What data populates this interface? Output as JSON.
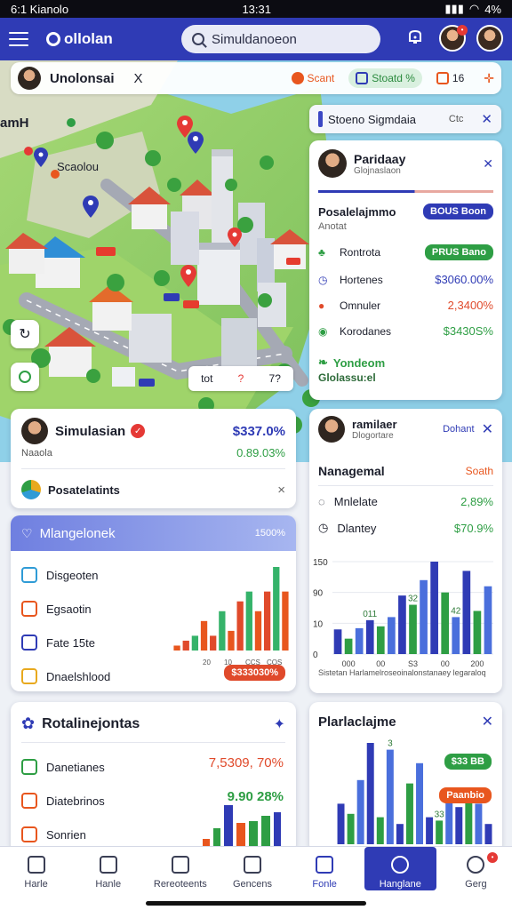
{
  "status_bar": {
    "left": "6:1 Kianolo",
    "time": "13:31",
    "battery": "4%"
  },
  "app": {
    "title": "ollolan",
    "search_placeholder": "Simuldanoeon"
  },
  "map_header": {
    "location": "Unolonsai",
    "close_glyph": "X",
    "chips": [
      {
        "label": "Scant",
        "color": "#e8561e"
      },
      {
        "label": "Stoatd %",
        "color": "#2b8a3e"
      },
      {
        "label": "16",
        "color": "#e8561e"
      }
    ]
  },
  "map": {
    "left_label": "amH",
    "place_label": "Scaolou",
    "scale_text": "ta",
    "controls": [
      "tot",
      "?",
      "7?"
    ]
  },
  "sim_strip": {
    "label": "Stoeno Sigmdaia",
    "action": "Ctc"
  },
  "profile_card": {
    "name": "Paridaay",
    "subtitle": "Glojnaslaon",
    "section_title": "Posalelajmmo",
    "section_pill": "BOUS Boon",
    "section_sub": "Anotat",
    "rows": [
      {
        "label": "Rontrota",
        "value": "PRUS Bano",
        "value_type": "pill",
        "color": "#2e9e44",
        "icon": "leaf-icon"
      },
      {
        "label": "Hortenes",
        "value": "$3060.00%",
        "value_type": "text",
        "color": "#2f3bb5",
        "icon": "clock-icon"
      },
      {
        "label": "Omnuler",
        "value": "2,3400%",
        "value_type": "text",
        "color": "#e04a2b",
        "icon": "alert-icon"
      },
      {
        "label": "Korodanes",
        "value": "$3430S%",
        "value_type": "text",
        "color": "#2e9e44",
        "icon": "target-icon"
      }
    ],
    "footer_line1": "Yondeom",
    "footer_line2": "Glolassu:el"
  },
  "simulation_card": {
    "title": "Simulasian",
    "value1": "$337.0%",
    "sub": "Naaola",
    "value2": "0.89.03%",
    "item": "Posatelatints",
    "close_glyph": "×"
  },
  "mangement_card": {
    "header": "Mlangelonek",
    "header_value": "1500%",
    "rows": [
      {
        "label": "Disgeoten",
        "icon": "chart-icon",
        "color": "#2f9bd6"
      },
      {
        "label": "Egsaotin",
        "icon": "flag-icon",
        "color": "#e8561e"
      },
      {
        "label": "Fate 15te",
        "icon": "box-icon",
        "color": "#2f3bb5"
      },
      {
        "label": "Dnaelshlood",
        "icon": "shield-icon",
        "color": "#e8a91e"
      }
    ],
    "pill": "$333030%",
    "chart_labels": [
      "20",
      "10",
      "CCS",
      "COS"
    ]
  },
  "right_card": {
    "name": "ramilaer",
    "sub": "Dlogortare",
    "action": "Dohant",
    "title": "Nanagemal",
    "title_action": "Soath",
    "rows": [
      {
        "label": "Mnlelate",
        "value": "2,89%",
        "color": "#2e9e44"
      },
      {
        "label": "Dlantey",
        "value": "$70.9%",
        "color": "#2e9e44"
      }
    ],
    "footer": "Sistetan Harlamelroseoinalonstanaey legaraloq"
  },
  "totals_card": {
    "title": "Rotalinejontas",
    "rows": [
      {
        "label": "Danetianes",
        "color": "#2e9e44",
        "icon": "chart-icon"
      },
      {
        "label": "Diatebrinos",
        "color": "#e8561e",
        "icon": "flag-icon"
      },
      {
        "label": "Sonrien",
        "color": "#e8561e",
        "icon": "box-icon"
      }
    ],
    "value1": "7,5309, 70%",
    "value2": "9.90 28%"
  },
  "plan_card": {
    "title": "Plarlaclajme",
    "pill1": "$33 BB",
    "pill2": "Paanbio"
  },
  "bottom_nav": [
    {
      "label": "Harle",
      "icon": "home-icon"
    },
    {
      "label": "Hanle",
      "icon": "calendar-icon"
    },
    {
      "label": "Rereoteents",
      "icon": "report-icon"
    },
    {
      "label": "Gencens",
      "icon": "check-icon"
    },
    {
      "label": "Fonle",
      "icon": "home-icon"
    },
    {
      "label": "Hanglane",
      "icon": "info-icon"
    },
    {
      "label": "Gerg",
      "icon": "settings-icon"
    }
  ],
  "chart_data": [
    {
      "type": "bar",
      "title": "",
      "series_colors": [
        "#e8561e",
        "#2e9e44",
        "#2f3bb5",
        "#e8561e"
      ],
      "values": [
        1,
        2,
        3,
        6,
        3,
        8,
        4,
        10,
        12,
        8,
        12,
        17,
        12
      ]
    },
    {
      "type": "bar",
      "title": "Nanagemal",
      "ytick_labels": [
        "150",
        "90",
        "10",
        "0"
      ],
      "xtick_labels": [
        "000",
        "00",
        "S3",
        "00",
        "200"
      ],
      "top_labels": [
        "011",
        "32",
        "42"
      ],
      "values": [
        40,
        25,
        42,
        55,
        45,
        60,
        95,
        80,
        120,
        150,
        100,
        60,
        135,
        70,
        110
      ]
    },
    {
      "type": "bar",
      "title": "Plarlaclajme",
      "top_labels": [
        "3",
        "33"
      ],
      "values": [
        60,
        45,
        95,
        150,
        40,
        140,
        30,
        90,
        120,
        40,
        35,
        80,
        55,
        70,
        60,
        30
      ]
    }
  ]
}
